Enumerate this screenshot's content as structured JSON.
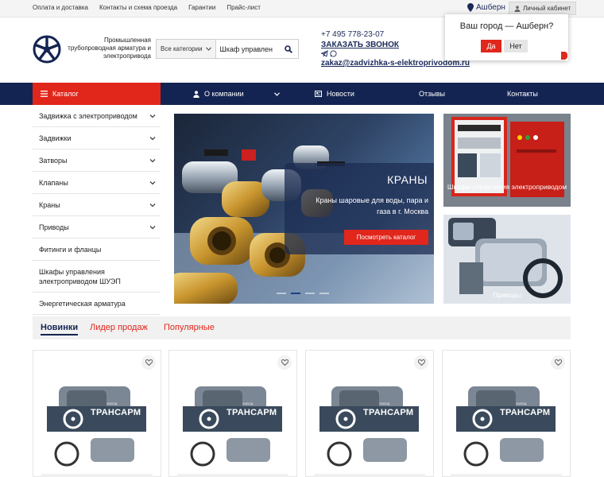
{
  "topbar": {
    "links": [
      "Оплата и доставка",
      "Контакты и схема проезда",
      "Гарантии",
      "Прайс-лист"
    ],
    "city": "Ашберн",
    "cabinet": "Личный кабинет"
  },
  "header": {
    "logo_text": "Промышленная трубопроводная арматура и электропривода",
    "search_category": "Все категории",
    "search_value": "Шкаф управлен",
    "phone": "+7 495 778-23-07",
    "callback": "ЗАКАЗАТЬ ЗВОНОК",
    "email": "zakaz@zadvizhka-s-elektroprivodom.ru"
  },
  "city_popup": {
    "question": "Ваш город — Ашберн?",
    "yes": "Да",
    "no": "Нет"
  },
  "nav": {
    "catalog": "Каталог",
    "items": [
      "О компании",
      "Новости",
      "Отзывы",
      "Контакты"
    ]
  },
  "sidebar": {
    "items": [
      "Задвижка с электроприводом",
      "Задвижки",
      "Затворы",
      "Клапаны",
      "Краны",
      "Приводы",
      "Фитинги и фланцы",
      "Шкафы управления электроприводом ШУЭП",
      "Энергетическая арматура"
    ]
  },
  "slider": {
    "title": "КРАНЫ",
    "description": "Краны шаровые для воды, пара и газа в г. Москва",
    "button": "Посмотреть каталог"
  },
  "banners": {
    "top": "Шкафы управления электроприводом",
    "bottom": "Приводы"
  },
  "tabs": [
    "Новинки",
    "Лидер продаж",
    "Популярные"
  ],
  "products": {
    "brand": "ТРАНСАРМ",
    "brand_sub": "ЗАВОД"
  },
  "colors": {
    "accent": "#e1261c",
    "navy": "#142452"
  }
}
